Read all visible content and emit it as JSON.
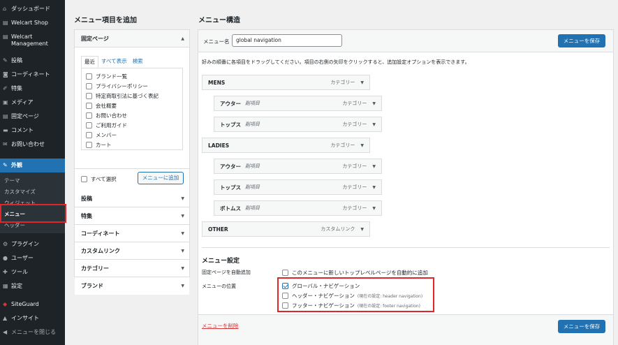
{
  "sidebar": {
    "items": [
      {
        "icon": "dashboard-icon",
        "glyph": "⌂",
        "label": "ダッシュボード"
      },
      {
        "icon": "cart-icon",
        "glyph": "🛒",
        "label": "Welcart Shop"
      },
      {
        "icon": "cart-icon",
        "glyph": "🛒",
        "label": "Welcart Management"
      },
      {
        "icon": "pin-icon",
        "glyph": "✎",
        "label": "投稿"
      },
      {
        "icon": "camera-icon",
        "glyph": "◙",
        "label": "コーディネート"
      },
      {
        "icon": "pen-icon",
        "glyph": "✐",
        "label": "特集"
      },
      {
        "icon": "media-icon",
        "glyph": "▣",
        "label": "メディア"
      },
      {
        "icon": "page-icon",
        "glyph": "▤",
        "label": "固定ページ"
      },
      {
        "icon": "comment-icon",
        "glyph": "▬",
        "label": "コメント"
      },
      {
        "icon": "mail-icon",
        "glyph": "✉",
        "label": "お問い合わせ"
      },
      {
        "icon": "appearance-icon",
        "glyph": "✎",
        "label": "外観"
      },
      {
        "icon": "plugin-icon",
        "glyph": "⚙",
        "label": "プラグイン"
      },
      {
        "icon": "user-icon",
        "glyph": "●",
        "label": "ユーザー"
      },
      {
        "icon": "tool-icon",
        "glyph": "✚",
        "label": "ツール"
      },
      {
        "icon": "settings-icon",
        "glyph": "▦",
        "label": "設定"
      },
      {
        "icon": "siteguard-icon",
        "glyph": "◆",
        "label": "SiteGuard"
      },
      {
        "icon": "insight-icon",
        "glyph": "▲",
        "label": "インサイト"
      },
      {
        "icon": "collapse-icon",
        "glyph": "◀",
        "label": "メニューを閉じる"
      }
    ],
    "appearance_sub": [
      "テーマ",
      "カスタマイズ",
      "ウィジェット",
      "メニュー",
      "ヘッダー"
    ]
  },
  "add_items": {
    "heading": "メニュー項目を追加",
    "fixed_pages": {
      "title": "固定ページ",
      "tabs": [
        "最近",
        "すべて表示",
        "検索"
      ],
      "pages": [
        "ブランド一覧",
        "プライバシーポリシー",
        "特定商取引法に基づく表記",
        "会社概要",
        "お問い合わせ",
        "ご利用ガイド",
        "メンバー",
        "カート"
      ],
      "select_all": "すべて選択",
      "add_button": "メニューに追加"
    },
    "sections": [
      "投稿",
      "特集",
      "コーディネート",
      "カスタムリンク",
      "カテゴリー",
      "ブランド"
    ]
  },
  "structure": {
    "heading": "メニュー構造",
    "name_label": "メニュー名",
    "name_value": "global navigation",
    "save_label": "メニューを保存",
    "instructions": "好みの順番に各項目をドラッグしてください。項目の右側の矢印をクリックすると、追加設定オプションを表示できます。",
    "items": [
      {
        "title": "MENS",
        "sub": "",
        "type": "カテゴリー"
      },
      {
        "title": "アウター",
        "sub": "副項目",
        "type": "カテゴリー"
      },
      {
        "title": "トップス",
        "sub": "副項目",
        "type": "カテゴリー"
      },
      {
        "title": "LADIES",
        "sub": "",
        "type": "カテゴリー"
      },
      {
        "title": "アウター",
        "sub": "副項目",
        "type": "カテゴリー"
      },
      {
        "title": "トップス",
        "sub": "副項目",
        "type": "カテゴリー"
      },
      {
        "title": "ボトムス",
        "sub": "副項目",
        "type": "カテゴリー"
      },
      {
        "title": "OTHER",
        "sub": "",
        "type": "カスタムリンク"
      }
    ],
    "settings": {
      "heading": "メニュー設定",
      "auto_add_label": "固定ページを自動追加",
      "auto_add_option": "このメニューに新しいトップレベルページを自動的に追加",
      "location_label": "メニューの位置",
      "locations": [
        {
          "name": "グローバル・ナビゲーション",
          "note": "",
          "checked": true
        },
        {
          "name": "ヘッダー・ナビゲーション",
          "note": "(現在の設定: header navigation)",
          "checked": false
        },
        {
          "name": "フッター・ナビゲーション",
          "note": "(現在の設定: footer navigation)",
          "checked": false
        }
      ]
    },
    "delete_label": "メニューを削除"
  }
}
